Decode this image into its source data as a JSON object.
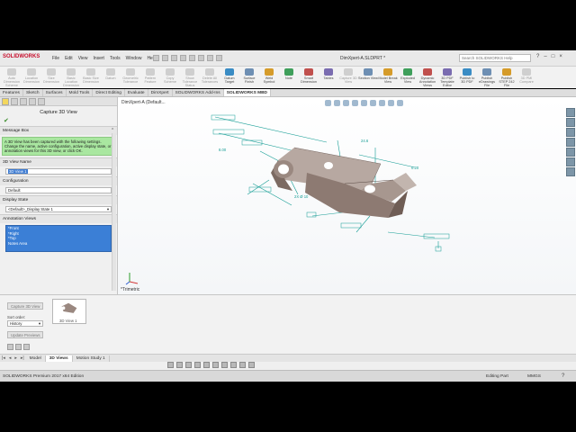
{
  "app": {
    "logo": "SOLIDWORKS",
    "doc_title": "DimXpert-A.SLDPRT *",
    "search_placeholder": "Search SOLIDWORKS Help",
    "menu": [
      "File",
      "Edit",
      "View",
      "Insert",
      "Tools",
      "Window",
      "Help"
    ]
  },
  "toolbar": [
    {
      "label": "Auto Dimension Scheme",
      "icon": "auto-dimension-icon",
      "dim": true
    },
    {
      "label": "Location Dimension",
      "icon": "location-dimension-icon",
      "dim": true
    },
    {
      "label": "Size Dimension",
      "icon": "size-dimension-icon",
      "dim": true
    },
    {
      "label": "Basic Location Dimension",
      "icon": "basic-location-icon",
      "dim": true
    },
    {
      "label": "Basic Size Dimension",
      "icon": "basic-size-icon",
      "dim": true
    },
    {
      "label": "Datum",
      "icon": "datum-icon",
      "dim": true
    },
    {
      "label": "Geometric Tolerance",
      "icon": "geometric-tolerance-icon",
      "dim": true
    },
    {
      "label": "Pattern Feature",
      "icon": "pattern-feature-icon",
      "dim": true
    },
    {
      "label": "Copy Scheme",
      "icon": "copy-scheme-icon",
      "dim": true
    },
    {
      "label": "Show Tolerance Status",
      "icon": "tolerance-status-icon",
      "dim": true
    },
    {
      "label": "Delete All Tolerances",
      "icon": "delete-tolerances-icon",
      "dim": true
    },
    {
      "label": "Datum Target",
      "icon": "datum-target-icon",
      "dim": false
    },
    {
      "label": "Surface Finish",
      "icon": "surface-finish-icon",
      "dim": false
    },
    {
      "label": "Weld Symbol",
      "icon": "weld-symbol-icon",
      "dim": false
    },
    {
      "label": "Note",
      "icon": "note-icon",
      "dim": false
    },
    {
      "label": "Smart Dimension",
      "icon": "smart-dimension-icon",
      "dim": false
    },
    {
      "label": "Tables",
      "icon": "tables-icon",
      "dim": false
    },
    {
      "label": "Capture 3D View",
      "icon": "capture-3d-view-icon",
      "dim": true
    },
    {
      "label": "Section View",
      "icon": "section-view-icon",
      "dim": false
    },
    {
      "label": "Model Break View",
      "icon": "model-break-view-icon",
      "dim": false
    },
    {
      "label": "Exploded View",
      "icon": "exploded-view-icon",
      "dim": false
    },
    {
      "label": "Dynamic Annotation Views",
      "icon": "dynamic-annotation-icon",
      "dim": false
    },
    {
      "label": "3D PDF Template Editor",
      "icon": "pdf-template-icon",
      "dim": false
    },
    {
      "label": "Publish to 3D PDF",
      "icon": "publish-3d-pdf-icon",
      "dim": false
    },
    {
      "label": "Publish eDrawings File",
      "icon": "publish-edrawings-icon",
      "dim": false
    },
    {
      "label": "Publish STEP 242 File",
      "icon": "publish-step-icon",
      "dim": false
    },
    {
      "label": "3D PMI Compare",
      "icon": "pmi-compare-icon",
      "dim": true
    }
  ],
  "cm_tabs": [
    "Features",
    "Sketch",
    "Surfaces",
    "Mold Tools",
    "Direct Editing",
    "Evaluate",
    "DimXpert",
    "SOLIDWORKS Add-Ins",
    "SOLIDWORKS MBD"
  ],
  "cm_active": "SOLIDWORKS MBD",
  "panel": {
    "title": "Capture 3D View",
    "message_header": "Message Box",
    "message": "A 3D View has been captured with the following settings. Change the name, active configuration, active display state, or annotation views for this 3D view, or click OK.",
    "view_name_header": "3D View Name",
    "view_name": "3D View 1",
    "configuration_header": "Configuration",
    "configuration": "Default",
    "display_state_header": "Display State",
    "display_state": "<Default>_Display State 1",
    "annotation_views_header": "Annotation Views",
    "annotation_views": [
      "*Front",
      "*Right",
      "*Top",
      "Notes Area"
    ]
  },
  "viewport": {
    "tree_label": "DimXpert-A (Default...",
    "view_orientation": "*Trimetric"
  },
  "annotations": {
    "d1": "24.6",
    "d2": "8.00",
    "d3": "0.20",
    "d4": "2X Ø 10"
  },
  "bottom": {
    "capture_button": "Capture 3D View",
    "thumb_label": "3D View 1",
    "sort_label": "Sort order:",
    "sort_value": "History",
    "update_button": "Update Previews"
  },
  "bottom_tabs": [
    "Model",
    "3D Views",
    "Motion Study 1"
  ],
  "bottom_active": "3D Views",
  "status": {
    "product": "SOLIDWORKS Premium 2017 x64 Edition",
    "mode": "Editing Part",
    "units": "MMGS",
    "help": "?"
  },
  "colors": {
    "logo_red": "#c8102e",
    "message_green": "#a9e7a0",
    "selection_blue": "#3b7fd6",
    "model_brown": "#8d7a72",
    "annotation_teal": "#139c94"
  }
}
